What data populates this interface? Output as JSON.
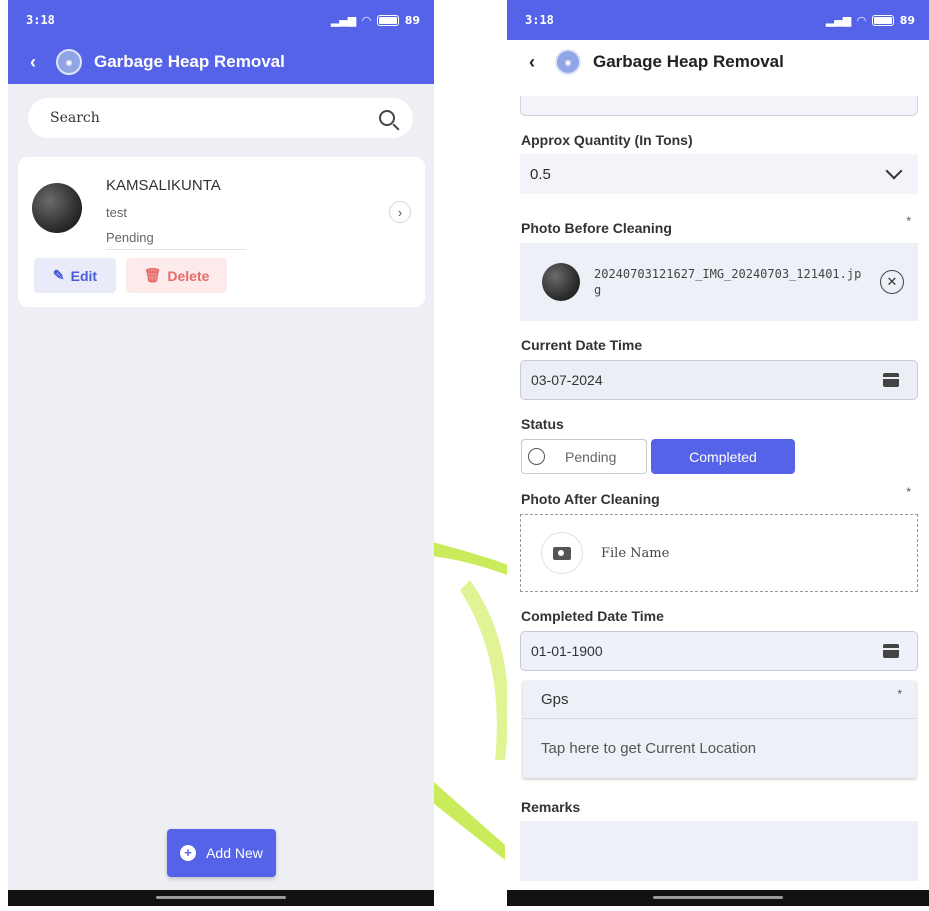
{
  "colors": {
    "primary": "#5563e8",
    "watermark": "#b9e63a",
    "danger": "#e86c6c"
  },
  "status_bar": {
    "time": "3:18",
    "battery": "89"
  },
  "left_screen": {
    "title": "Garbage Heap Removal",
    "search_placeholder": "Search",
    "records": [
      {
        "name": "KAMSALIKUNTA",
        "detail": "test",
        "status": "Pending",
        "edit_label": "Edit",
        "delete_label": "Delete"
      }
    ],
    "add_new_label": "Add New"
  },
  "right_screen": {
    "title": "Garbage Heap Removal",
    "quantity": {
      "label": "Approx Quantity (In Tons)",
      "value": "0.5"
    },
    "photo_before": {
      "label": "Photo Before Cleaning",
      "required_mark": "*",
      "file_name": "20240703121627_IMG_20240703_121401.jpg"
    },
    "current_datetime": {
      "label": "Current Date Time",
      "value": "03-07-2024"
    },
    "status": {
      "label": "Status",
      "options": [
        "Pending",
        "Completed"
      ],
      "selected": "Completed"
    },
    "photo_after": {
      "label": "Photo After Cleaning",
      "required_mark": "*",
      "placeholder": "File Name"
    },
    "completed_datetime": {
      "label": "Completed Date Time",
      "value": "01-01-1900"
    },
    "gps": {
      "label": "Gps",
      "required_mark": "*",
      "action": "Tap here to get Current Location"
    },
    "remarks": {
      "label": "Remarks",
      "value": ""
    }
  }
}
